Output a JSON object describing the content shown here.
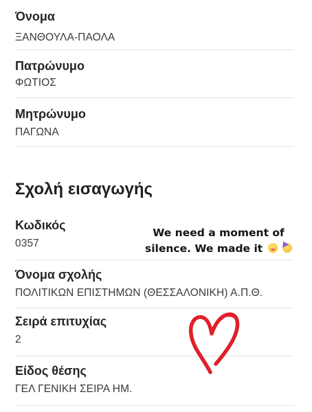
{
  "fields": {
    "onoma": {
      "label": "Όνομα",
      "value": "ΞΑΝΘΟΥΛΑ-ΠΑΟΛΑ"
    },
    "patronymo": {
      "label": "Πατρώνυμο",
      "value": "ΦΩΤΙΟΣ"
    },
    "mitronymo": {
      "label": "Μητρώνυμο",
      "value": "ΠΑΓΩΝΑ"
    }
  },
  "section": {
    "title": "Σχολή εισαγωγής",
    "fields": {
      "kodikos": {
        "label": "Κωδικός",
        "value": "0357"
      },
      "onoma_sxolis": {
        "label": "Όνομα σχολής",
        "value": "ΠΟΛΙΤΙΚΩΝ ΕΠΙΣΤΗΜΩΝ (ΘΕΣΣΑΛΟΝΙΚΗ) Α.Π.Θ."
      },
      "seira": {
        "label": "Σειρά επιτυχίας",
        "value": "2"
      },
      "eidos": {
        "label": "Είδος θέσης",
        "value": "ΓΕΛ ΓΕΝΙΚΗ ΣΕΙΡΑ ΗΜ."
      }
    }
  },
  "overlay": {
    "line1": "We need a moment of",
    "line2": "silence. We made it",
    "emojis": [
      "dizzy-face-emoji",
      "partying-face-emoji"
    ]
  },
  "colors": {
    "heart": "#e0202a",
    "divider": "#e3e3e3",
    "label": "#262626",
    "value": "#3a3a3a"
  }
}
